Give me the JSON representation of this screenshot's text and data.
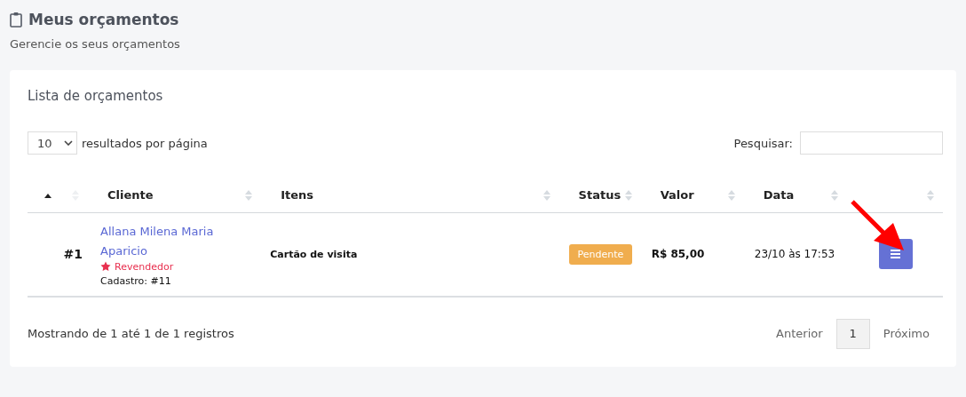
{
  "page": {
    "title": "Meus orçamentos",
    "subtitle": "Gerencie os seus orçamentos"
  },
  "card": {
    "title": "Lista de orçamentos",
    "page_size": {
      "value": "10",
      "label": "resultados por página"
    },
    "search": {
      "label": "Pesquisar:"
    },
    "columns": [
      {
        "sorted": true
      },
      {
        "label": "Cliente",
        "sorted": false
      },
      {
        "label": "Itens",
        "sorted": false
      },
      {
        "label": "Status",
        "sorted": false
      },
      {
        "label": "Valor",
        "sorted": false
      },
      {
        "label": "Data",
        "sorted": false
      },
      {
        "sorted": false
      }
    ],
    "rows": [
      {
        "number": "#1",
        "client": "Allana Milena Maria Aparicio",
        "badge": {
          "kind": "star",
          "label": "Revendedor"
        },
        "registration": "Cadastro: #11",
        "items": "Cartão de visita",
        "status": {
          "label": "Pendente",
          "color": "#f0ad4e"
        },
        "value": "R$ 85,00",
        "date": "23/10 às 17:53"
      }
    ],
    "info": "Mostrando de 1 até 1 de 1 registros",
    "pagination": [
      {
        "label": "Anterior",
        "kind": "link",
        "selected": false
      },
      {
        "label": "1",
        "kind": "page",
        "selected": true
      },
      {
        "label": "Próximo",
        "kind": "link",
        "selected": false
      }
    ]
  }
}
